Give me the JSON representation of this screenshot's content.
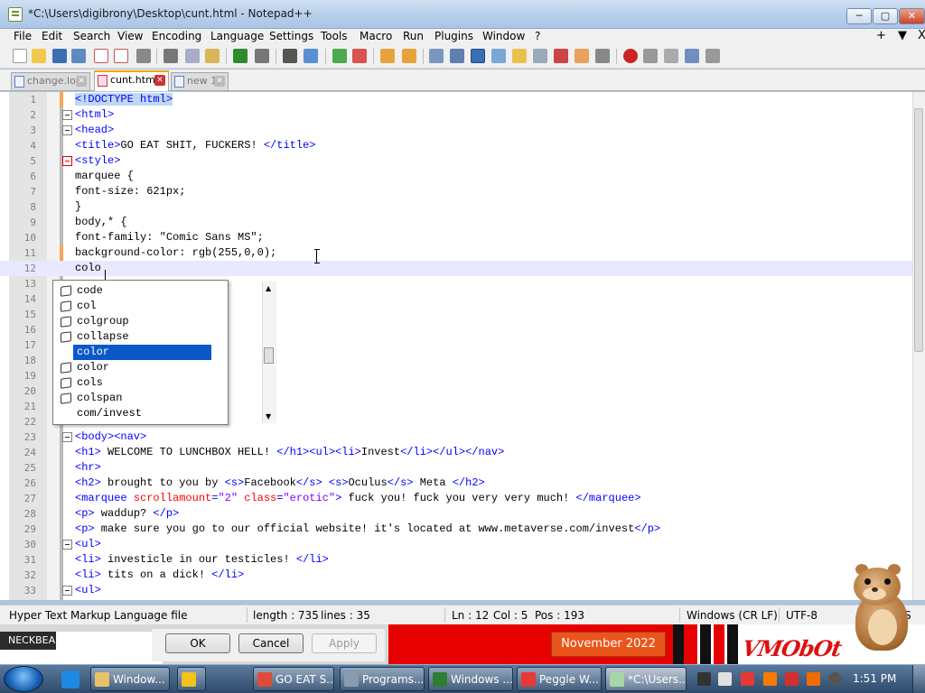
{
  "window": {
    "title": "*C:\\Users\\digibrony\\Desktop\\cunt.html - Notepad++",
    "minimize": "─",
    "maximize": "▢",
    "close": "✕"
  },
  "menu": {
    "items": [
      "File",
      "Edit",
      "Search",
      "View",
      "Encoding",
      "Language",
      "Settings",
      "Tools",
      "Macro",
      "Run",
      "Plugins",
      "Window",
      "?"
    ],
    "right": [
      "+",
      "▼",
      "X"
    ]
  },
  "tabs": [
    {
      "label": "change.log",
      "active": false
    },
    {
      "label": "cunt.html",
      "active": true
    },
    {
      "label": "new 1",
      "active": false
    }
  ],
  "editor": {
    "lines": [
      {
        "n": "1",
        "segments": [
          {
            "t": "<!",
            "c": "tag hl"
          },
          {
            "t": "DOCTYPE html",
            "c": "tag hl"
          },
          {
            "t": ">",
            "c": "tag hl"
          }
        ]
      },
      {
        "n": "2",
        "segments": [
          {
            "t": "<html>",
            "c": "tag"
          }
        ]
      },
      {
        "n": "3",
        "segments": [
          {
            "t": "<head>",
            "c": "tag"
          }
        ]
      },
      {
        "n": "4",
        "segments": [
          {
            "t": "<title>",
            "c": "tag"
          },
          {
            "t": "GO EAT SHIT, FUCKERS! ",
            "c": "plain"
          },
          {
            "t": "</title>",
            "c": "tag"
          }
        ]
      },
      {
        "n": "5",
        "segments": [
          {
            "t": "<style>",
            "c": "tag"
          }
        ]
      },
      {
        "n": "6",
        "segments": [
          {
            "t": "marquee {",
            "c": "plain"
          }
        ]
      },
      {
        "n": "7",
        "segments": [
          {
            "t": "font-size: 621px;",
            "c": "plain"
          }
        ]
      },
      {
        "n": "8",
        "segments": [
          {
            "t": "}",
            "c": "plain"
          }
        ]
      },
      {
        "n": "9",
        "segments": [
          {
            "t": "body,* {",
            "c": "plain"
          }
        ]
      },
      {
        "n": "10",
        "segments": [
          {
            "t": "font-family: \"Comic Sans MS\";",
            "c": "plain"
          }
        ]
      },
      {
        "n": "11",
        "segments": [
          {
            "t": "background-color: rgb(255,0,0);",
            "c": "plain"
          }
        ]
      },
      {
        "n": "12",
        "segments": [
          {
            "t": "colo",
            "c": "plain"
          }
        ]
      },
      {
        "n": "13",
        "segments": []
      },
      {
        "n": "14",
        "segments": []
      },
      {
        "n": "15",
        "segments": []
      },
      {
        "n": "16",
        "segments": []
      },
      {
        "n": "17",
        "segments": []
      },
      {
        "n": "18",
        "segments": []
      },
      {
        "n": "19",
        "segments": []
      },
      {
        "n": "20",
        "segments": []
      },
      {
        "n": "21",
        "segments": []
      },
      {
        "n": "22",
        "segments": []
      },
      {
        "n": "23",
        "segments": [
          {
            "t": "<body><nav>",
            "c": "tag"
          }
        ]
      },
      {
        "n": "24",
        "segments": [
          {
            "t": "<h1>",
            "c": "tag"
          },
          {
            "t": " WELCOME TO LUNCHBOX HELL! ",
            "c": "plain"
          },
          {
            "t": "</h1><ul><li>",
            "c": "tag"
          },
          {
            "t": "Invest",
            "c": "plain"
          },
          {
            "t": "</li></ul></nav>",
            "c": "tag"
          }
        ]
      },
      {
        "n": "25",
        "segments": [
          {
            "t": "<hr>",
            "c": "tag"
          }
        ]
      },
      {
        "n": "26",
        "segments": [
          {
            "t": "<h2>",
            "c": "tag"
          },
          {
            "t": " brought to you by ",
            "c": "plain"
          },
          {
            "t": "<s>",
            "c": "tag"
          },
          {
            "t": "Facebook",
            "c": "plain"
          },
          {
            "t": "</s>",
            "c": "tag"
          },
          {
            "t": " ",
            "c": "plain"
          },
          {
            "t": "<s>",
            "c": "tag"
          },
          {
            "t": "Oculus",
            "c": "plain"
          },
          {
            "t": "</s>",
            "c": "tag"
          },
          {
            "t": " Meta ",
            "c": "plain"
          },
          {
            "t": "</h2>",
            "c": "tag"
          }
        ]
      },
      {
        "n": "27",
        "segments": [
          {
            "t": "<marquee ",
            "c": "tag"
          },
          {
            "t": "scrollamount",
            "c": "attr"
          },
          {
            "t": "=",
            "c": "tag"
          },
          {
            "t": "\"2\"",
            "c": "str"
          },
          {
            "t": " ",
            "c": "tag"
          },
          {
            "t": "class",
            "c": "attr"
          },
          {
            "t": "=",
            "c": "tag"
          },
          {
            "t": "\"erotic\"",
            "c": "str"
          },
          {
            "t": ">",
            "c": "tag"
          },
          {
            "t": " fuck you! fuck you very very much! ",
            "c": "plain"
          },
          {
            "t": "</marquee>",
            "c": "tag"
          }
        ]
      },
      {
        "n": "28",
        "segments": [
          {
            "t": "<p>",
            "c": "tag"
          },
          {
            "t": " waddup? ",
            "c": "plain"
          },
          {
            "t": "</p>",
            "c": "tag"
          }
        ]
      },
      {
        "n": "29",
        "segments": [
          {
            "t": "<p>",
            "c": "tag"
          },
          {
            "t": " make sure you go to our official website! it's located at www.metaverse.com/invest",
            "c": "plain"
          },
          {
            "t": "</p>",
            "c": "tag"
          }
        ]
      },
      {
        "n": "30",
        "segments": [
          {
            "t": "<ul>",
            "c": "tag"
          }
        ]
      },
      {
        "n": "31",
        "segments": [
          {
            "t": "<li>",
            "c": "tag"
          },
          {
            "t": " investicle in our testicles! ",
            "c": "plain"
          },
          {
            "t": "</li>",
            "c": "tag"
          }
        ]
      },
      {
        "n": "32",
        "segments": [
          {
            "t": "<li>",
            "c": "tag"
          },
          {
            "t": " tits on a dick! ",
            "c": "plain"
          },
          {
            "t": "</li>",
            "c": "tag"
          }
        ]
      },
      {
        "n": "33",
        "segments": [
          {
            "t": "<ul>",
            "c": "tag"
          }
        ]
      }
    ]
  },
  "autocomplete": {
    "items": [
      {
        "label": "code",
        "icon": true,
        "selected": false
      },
      {
        "label": "col",
        "icon": true,
        "selected": false
      },
      {
        "label": "colgroup",
        "icon": true,
        "selected": false
      },
      {
        "label": "collapse",
        "icon": true,
        "selected": false
      },
      {
        "label": "color",
        "icon": false,
        "selected": true
      },
      {
        "label": "color",
        "icon": true,
        "selected": false
      },
      {
        "label": "cols",
        "icon": true,
        "selected": false
      },
      {
        "label": "colspan",
        "icon": true,
        "selected": false
      },
      {
        "label": "com/invest",
        "icon": false,
        "selected": false
      }
    ]
  },
  "status": {
    "filetype": "Hyper Text Markup Language file",
    "length": "length : 735",
    "lines": "lines : 35",
    "ln": "Ln : 12",
    "col": "Col : 5",
    "pos": "Pos : 193",
    "eol": "Windows (CR LF)",
    "encoding": "UTF-8",
    "mode": "S"
  },
  "background": {
    "neck_label": "NECKBEA",
    "ok": "OK",
    "cancel": "Cancel",
    "apply": "Apply",
    "date_banner": "November 2022",
    "watermark": "VMObOt"
  },
  "taskbar": {
    "buttons": [
      {
        "label": "Window...",
        "color": "#e8c266"
      },
      {
        "label": "",
        "color": "#f0c419"
      },
      {
        "label": "GO EAT S...",
        "color": "#dd4b39"
      },
      {
        "label": "Programs...",
        "color": "#8a9bb0"
      },
      {
        "label": "Windows ...",
        "color": "#2e7d32"
      },
      {
        "label": "Peggle W...",
        "color": "#e53935"
      },
      {
        "label": "*C:\\Users...",
        "color": "#a5d6a7"
      }
    ],
    "clock": "1:51 PM"
  },
  "colors": {
    "accent": "#0a59c9",
    "tag": "#0000ff",
    "attribute": "#ff0000",
    "string": "#8000ff",
    "active_tab": "#f8a400"
  }
}
